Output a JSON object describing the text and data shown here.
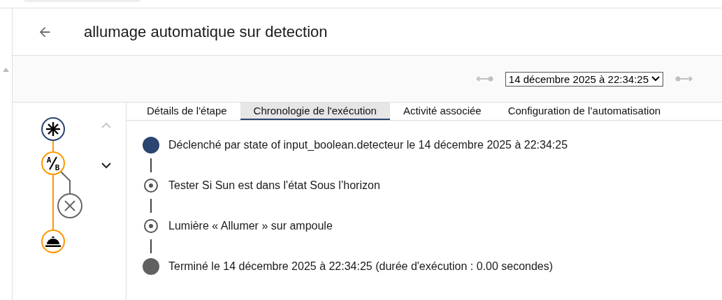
{
  "header": {
    "title": "allumage automatique sur detection"
  },
  "run_picker": {
    "value": "14 décembre 2025 à 22:34:25",
    "previous_disabled": true,
    "next_disabled": true
  },
  "graph": {
    "nodes": [
      {
        "kind": "trigger",
        "executed": true
      },
      {
        "kind": "condition",
        "executed": true,
        "letters": [
          "A",
          "B"
        ]
      },
      {
        "kind": "failed",
        "executed": false
      },
      {
        "kind": "action",
        "executed": true
      }
    ],
    "up_disabled": true,
    "down_disabled": false
  },
  "tabs": [
    {
      "label": "Détails de l'étape",
      "selected": false
    },
    {
      "label": "Chronologie de l'exécution",
      "selected": true
    },
    {
      "label": "Activité associée",
      "selected": false
    },
    {
      "label": "Configuration de l’automatisation",
      "selected": false
    }
  ],
  "timeline": [
    {
      "kind": "start",
      "text": "Déclenché par state of input_boolean.detecteur le 14 décembre 2025 à 22:34:25"
    },
    {
      "kind": "step",
      "text": "Tester Si Sun est dans l'état Sous l’horizon"
    },
    {
      "kind": "step",
      "text": "Lumière « Allumer » sur ampoule"
    },
    {
      "kind": "end",
      "text": "Terminé le 14 décembre 2025 à 22:34:25 (durée d'exécution : 0.00 secondes)"
    }
  ]
}
